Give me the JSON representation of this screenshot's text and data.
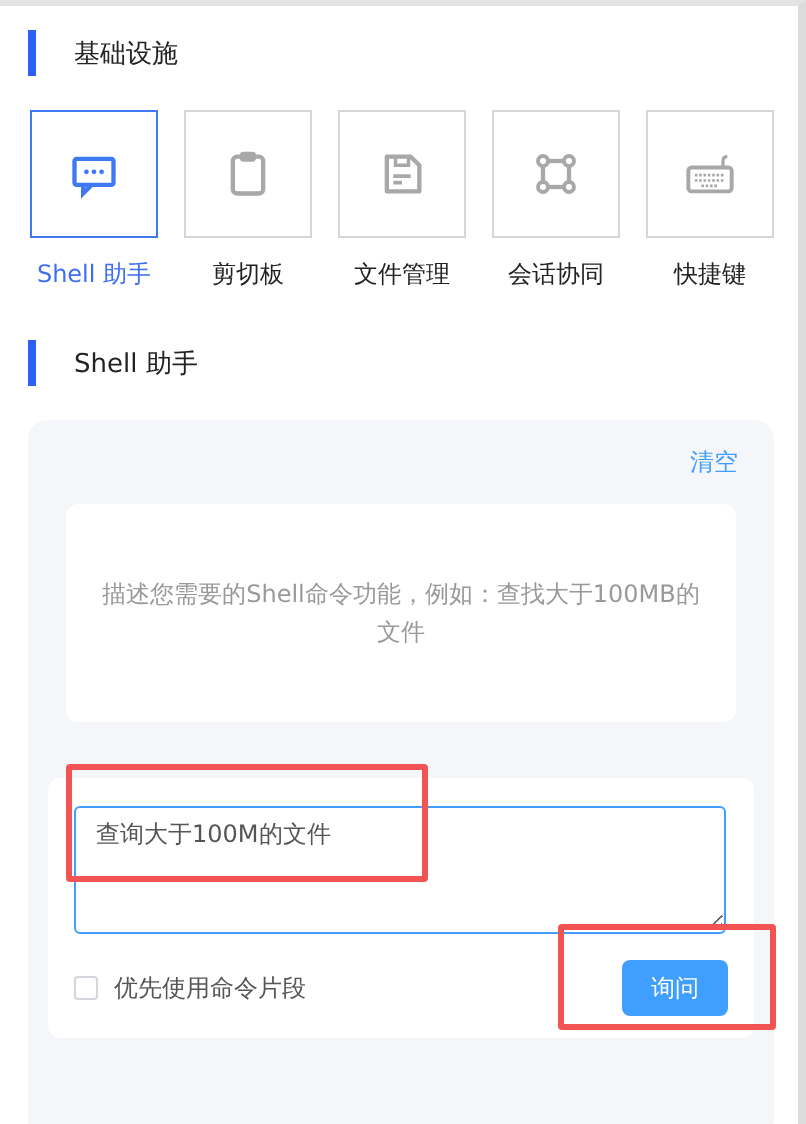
{
  "infra": {
    "title": "基础设施",
    "tools": [
      {
        "kind": "chat",
        "label": "Shell 助手",
        "selected": true
      },
      {
        "kind": "clipboard",
        "label": "剪切板",
        "selected": false
      },
      {
        "kind": "file",
        "label": "文件管理",
        "selected": false
      },
      {
        "kind": "share",
        "label": "会话协同",
        "selected": false
      },
      {
        "kind": "keyboard",
        "label": "快捷键",
        "selected": false
      }
    ]
  },
  "shell": {
    "title": "Shell 助手",
    "clear": "清空",
    "hint": "描述您需要的Shell命令功能，例如：查找大于100MB的文件",
    "input": {
      "value": "查询大于100M的文件"
    },
    "prefer": {
      "label": "优先使用命令片段",
      "checked": false
    },
    "ask": "询问"
  }
}
